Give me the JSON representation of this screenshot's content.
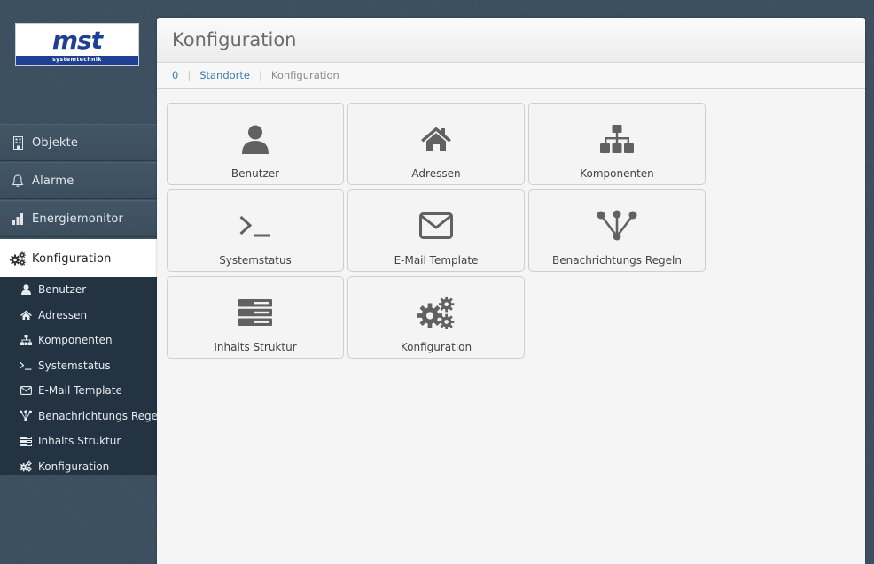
{
  "logo": {
    "text": "mst",
    "subtitle": "systemtechnik",
    "brand_color": "#1f3f94"
  },
  "nav": {
    "items": [
      {
        "id": "objekte",
        "label": "Objekte",
        "icon": "building-icon"
      },
      {
        "id": "alarme",
        "label": "Alarme",
        "icon": "bell-icon"
      },
      {
        "id": "energiemonitor",
        "label": "Energiemonitor",
        "icon": "bar-chart-icon"
      },
      {
        "id": "konfiguration",
        "label": "Konfiguration",
        "icon": "gears-icon",
        "active": true
      }
    ],
    "submenu": [
      {
        "label": "Benutzer",
        "icon": "user-icon"
      },
      {
        "label": "Adressen",
        "icon": "home-icon"
      },
      {
        "label": "Komponenten",
        "icon": "sitemap-icon"
      },
      {
        "label": "Systemstatus",
        "icon": "terminal-icon"
      },
      {
        "label": "E-Mail Template",
        "icon": "envelope-icon"
      },
      {
        "label": "Benachrichtungs Regeln",
        "icon": "share-nodes-icon"
      },
      {
        "label": "Inhalts Struktur",
        "icon": "server-icon"
      },
      {
        "label": "Konfiguration",
        "icon": "gears-icon"
      }
    ]
  },
  "header": {
    "title": "Konfiguration"
  },
  "breadcrumb": {
    "home": "0",
    "parent": "Standorte",
    "current": "Konfiguration"
  },
  "tiles": [
    {
      "label": "Benutzer",
      "icon": "user-icon"
    },
    {
      "label": "Adressen",
      "icon": "home-icon"
    },
    {
      "label": "Komponenten",
      "icon": "sitemap-icon"
    },
    {
      "label": "Systemstatus",
      "icon": "terminal-icon"
    },
    {
      "label": "E-Mail Template",
      "icon": "envelope-icon"
    },
    {
      "label": "Benachrichtungs Regeln",
      "icon": "share-nodes-icon"
    },
    {
      "label": "Inhalts Struktur",
      "icon": "server-icon"
    },
    {
      "label": "Konfiguration",
      "icon": "gears-icon"
    }
  ],
  "colors": {
    "icon_gray": "#616161",
    "link_blue": "#3a79b5",
    "sidebar_dark": "#243342"
  }
}
